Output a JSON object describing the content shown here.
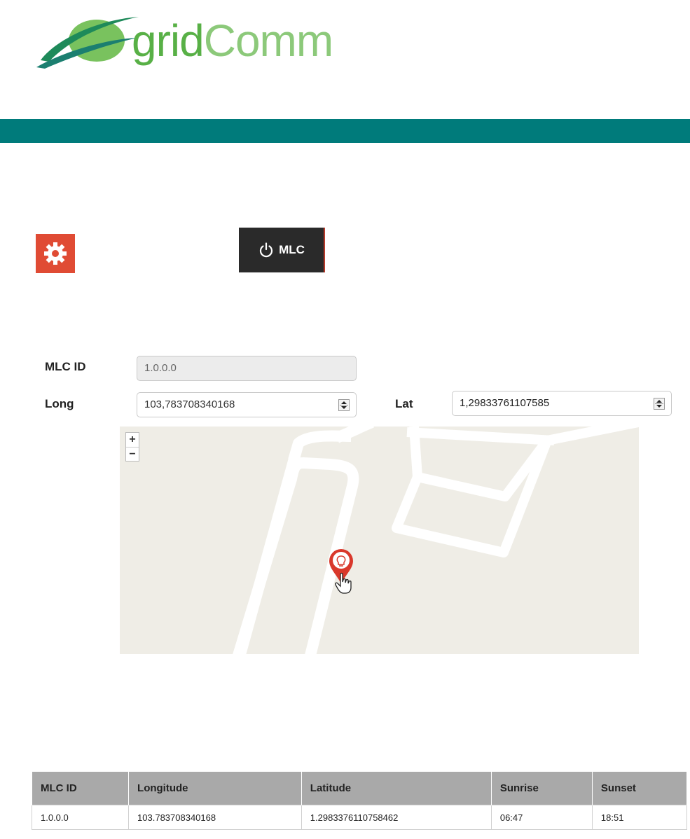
{
  "header": {
    "logo_part1": "grid",
    "logo_part2": "Comm"
  },
  "toolbar": {
    "settings_icon": "gear-icon",
    "mlc_button_label": "MLC",
    "mlc_button_icon": "power-icon"
  },
  "form": {
    "mlc_id_label": "MLC ID",
    "mlc_id_value": "1.0.0.0",
    "long_label": "Long",
    "long_value": "103,783708340168",
    "lat_label": "Lat",
    "lat_value": "1,29833761107585"
  },
  "map": {
    "zoom_in": "+",
    "zoom_out": "−",
    "marker_icon": "lightbulb-marker-icon",
    "cursor_icon": "hand-pointer-icon"
  },
  "table": {
    "headers": [
      "MLC ID",
      "Longitude",
      "Latitude",
      "Sunrise",
      "Sunset"
    ],
    "rows": [
      [
        "1.0.0.0",
        "103.783708340168",
        "1.2983376110758462",
        "06:47",
        "18:51"
      ]
    ]
  },
  "colors": {
    "band": "#007b7b",
    "settings_button": "#e04b34",
    "mlc_button": "#2a2a2a",
    "logo_green": "#58b046",
    "marker_red": "#d9382b"
  }
}
